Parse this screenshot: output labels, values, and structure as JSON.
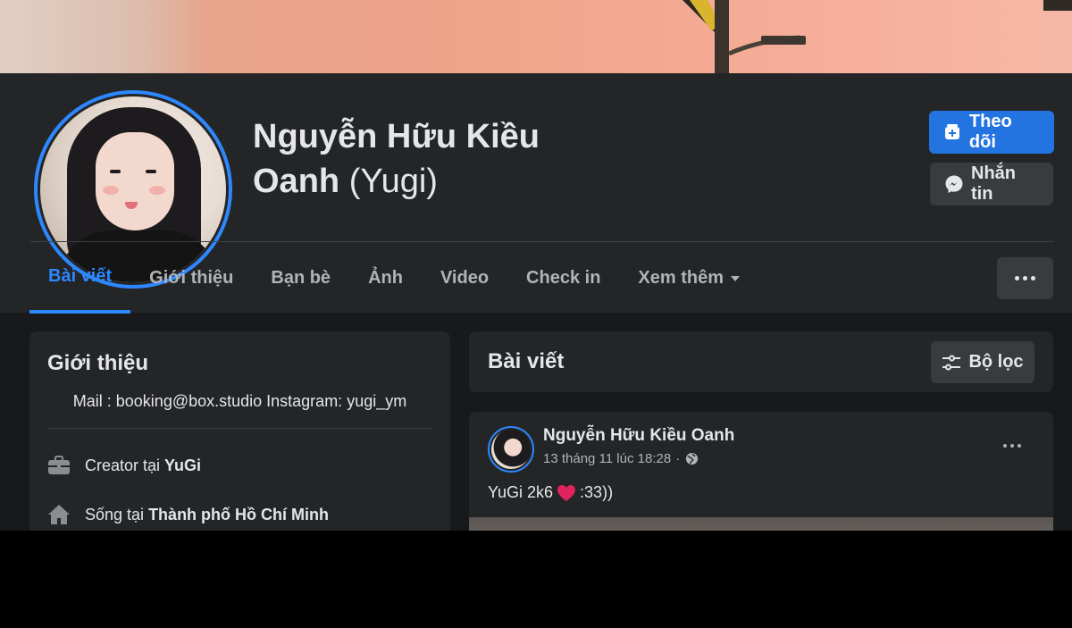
{
  "profile": {
    "name": "Nguyễn Hữu Kiều Oanh",
    "name_line1": "Nguyễn Hữu Kiều",
    "name_line2": "Oanh",
    "alternate_name": "(Yugi)"
  },
  "actions": {
    "follow_label": "Theo dõi",
    "message_label": "Nhắn tin"
  },
  "tabs": [
    {
      "label": "Bài viết",
      "active": true
    },
    {
      "label": "Giới thiệu",
      "active": false
    },
    {
      "label": "Bạn bè",
      "active": false
    },
    {
      "label": "Ảnh",
      "active": false
    },
    {
      "label": "Video",
      "active": false
    },
    {
      "label": "Check in",
      "active": false
    },
    {
      "label": "Xem thêm",
      "active": false
    }
  ],
  "intro": {
    "title": "Giới thiệu",
    "bio": "Mail : booking@box.studio Instagram: yugi_ym",
    "work_prefix": "Creator tại",
    "work_place": "YuGi",
    "live_prefix": "Sống tại",
    "live_place": "Thành phố Hồ Chí Minh"
  },
  "posts": {
    "title": "Bài viết",
    "filter_label": "Bộ lọc",
    "items": [
      {
        "author": "Nguyễn Hữu Kiều Oanh",
        "timestamp": "13 tháng 11 lúc 18:28",
        "separator": "·",
        "text_before": "YuGi 2k6",
        "text_after": ":33))"
      }
    ]
  },
  "colors": {
    "accent": "#2d88ff",
    "follow_button": "#2374e1",
    "background": "#18191a",
    "card": "#242526",
    "heart": "#e0245e"
  },
  "icons": [
    "follow-plus-icon",
    "messenger-icon",
    "more-dots-icon",
    "filter-icon",
    "briefcase-icon",
    "home-icon",
    "globe-icon",
    "heart-icon"
  ]
}
